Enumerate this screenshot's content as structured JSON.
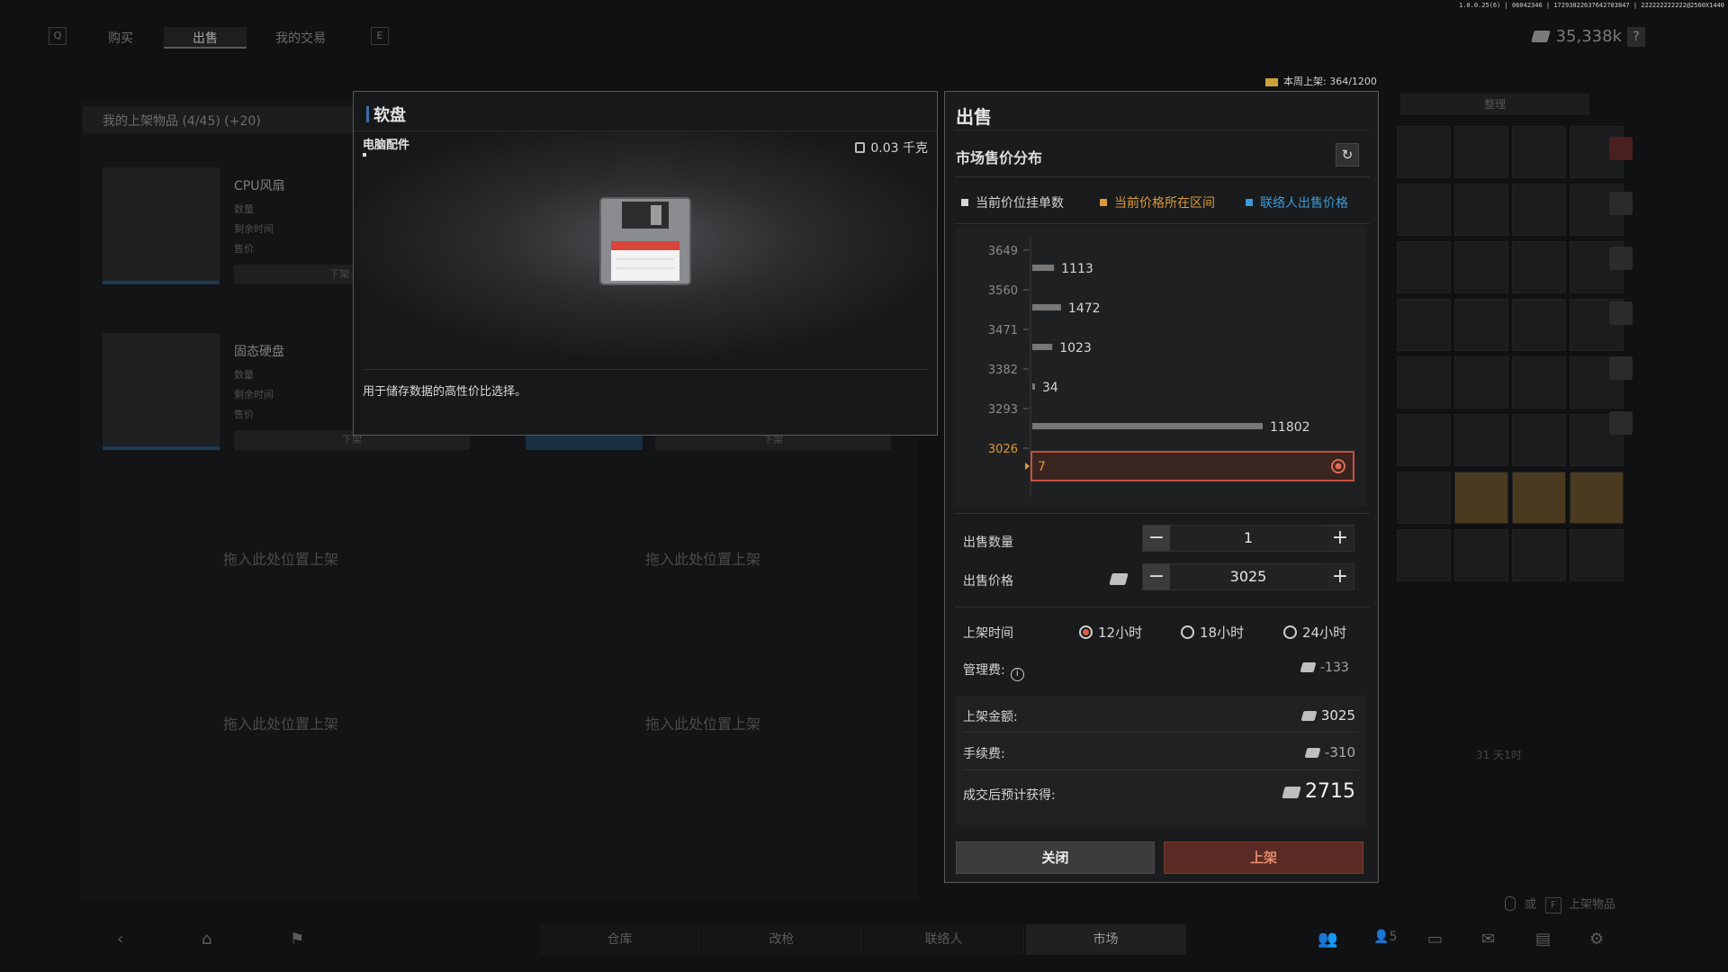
{
  "top": {
    "key_left": "Q",
    "tabs": [
      "购买",
      "出售",
      "我的交易"
    ],
    "key_right": "E",
    "currency": "35,338k",
    "help": "?",
    "debug": "1.0.0.25(6) | 06042346 | 17293822637642703847 | 222222222222@2560X1440",
    "weekly_label": "本周上架: 364/1200"
  },
  "listings": {
    "header": "我的上架物品 (4/45) (+20)",
    "items": [
      {
        "name": "CPU风扇",
        "l1": "数量",
        "l2": "剩余时间",
        "l3": "售价",
        "btn": "下架"
      },
      {
        "name": "固态硬盘",
        "l1": "数量",
        "l2": "剩余时间",
        "l3": "售价",
        "btn": "下架"
      }
    ],
    "drop_hint": "拖入此处位置上架",
    "second_btn": "下架"
  },
  "inventory": {
    "sort_label": "整理",
    "timer": "31 天1时"
  },
  "item": {
    "name": "软盘",
    "category": "电脑配件",
    "weight": "0.03 千克",
    "description": "用于储存数据的高性价比选择。"
  },
  "sell": {
    "title": "出售",
    "dist_title": "市场售价分布",
    "refresh_icon": "↻",
    "legend": [
      {
        "label": "当前价位挂单数",
        "color": "#d6d6d6"
      },
      {
        "label": "当前价格所在区间",
        "color": "#d99a3a"
      },
      {
        "label": "联络人出售价格",
        "color": "#3a9ad9"
      }
    ],
    "quantity_label": "出售数量",
    "quantity": "1",
    "price_label": "出售价格",
    "price": "3025",
    "duration_label": "上架时间",
    "durations": [
      "12小时",
      "18小时",
      "24小时"
    ],
    "selected_duration": "12小时",
    "mgmt_fee_label": "管理费:",
    "mgmt_fee": "-133",
    "listing_amount_label": "上架金额:",
    "listing_amount": "3025",
    "handling_fee_label": "手续费:",
    "handling_fee": "-310",
    "expected_label": "成交后预计获得:",
    "expected": "2715",
    "close_label": "关闭",
    "list_label": "上架"
  },
  "chart_data": {
    "type": "bar",
    "orientation": "horizontal",
    "categories": [
      "3649",
      "3560",
      "3471",
      "3382",
      "3293",
      "3026"
    ],
    "values": [
      1113,
      1472,
      1023,
      34,
      11802,
      7
    ],
    "highlight_category": "3026",
    "highlight_color": "#d99a3a",
    "bar_color": "#777777"
  },
  "nav": {
    "tabs": [
      "仓库",
      "改枪",
      "联络人",
      "市场"
    ],
    "active": "市场",
    "social_count": "5",
    "hint_key": "F",
    "hint_label": "上架物品",
    "hint_prefix": "或"
  }
}
